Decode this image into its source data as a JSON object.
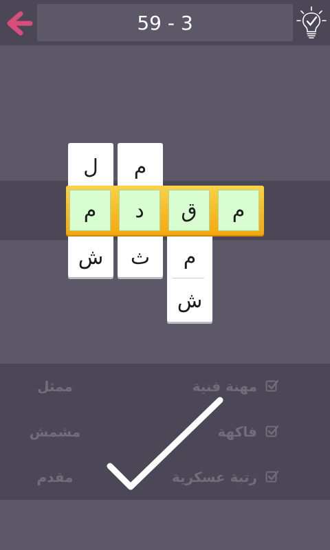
{
  "header": {
    "level_text": "59 - 3",
    "back_icon": "back-arrow-icon",
    "hint_icon": "lightbulb-check-icon",
    "back_color": "#d94d7a"
  },
  "board": {
    "columns": [
      {
        "top": "ل",
        "mid": "م",
        "bottom": "ش"
      },
      {
        "top": "م",
        "mid": "د",
        "bottom": "ث"
      },
      {
        "top": "",
        "mid": "ق",
        "bottom": "م",
        "bottom2": "ش"
      },
      {
        "top": "",
        "mid": "م",
        "bottom": ""
      }
    ],
    "answer_color": "#d7fdd0",
    "frame_color": "#f7b81f"
  },
  "clues": [
    {
      "text": "مهنة فنية",
      "word": "ممثل",
      "checked": true
    },
    {
      "text": "فاكهة",
      "word": "مشمش",
      "checked": true
    },
    {
      "text": "رتبة عسكرية",
      "word": "مقدم",
      "checked": true
    }
  ],
  "success_icon": "big-checkmark-icon"
}
